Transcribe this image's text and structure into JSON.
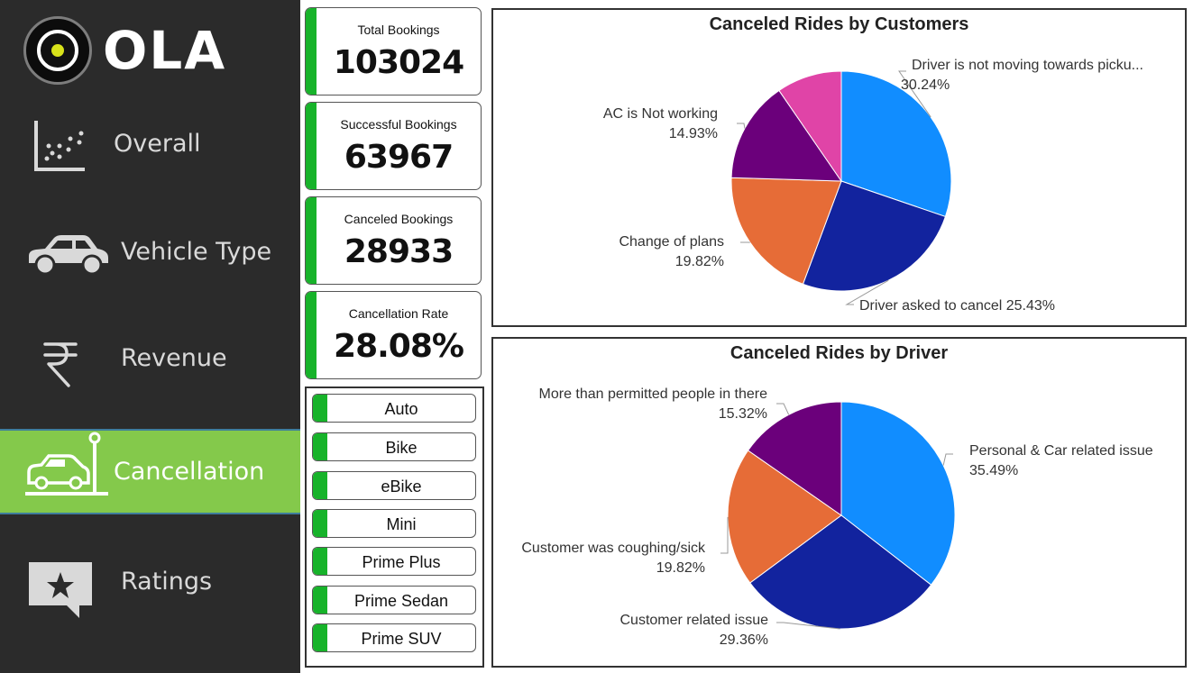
{
  "brand": {
    "name": "OLA"
  },
  "nav": {
    "items": [
      {
        "label": "Overall",
        "icon": "scatter-chart-icon"
      },
      {
        "label": "Vehicle Type",
        "icon": "car-icon"
      },
      {
        "label": "Revenue",
        "icon": "rupee-icon"
      },
      {
        "label": "Cancellation",
        "icon": "car-crash-icon"
      },
      {
        "label": "Ratings",
        "icon": "star-review-icon"
      }
    ],
    "active": "Cancellation"
  },
  "kpis": [
    {
      "title": "Total Bookings",
      "value": "103024"
    },
    {
      "title": "Successful Bookings",
      "value": "63967"
    },
    {
      "title": "Canceled Bookings",
      "value": "28933"
    },
    {
      "title": "Cancellation Rate",
      "value": "28.08%"
    }
  ],
  "vehicle_filter": {
    "options": [
      "Auto",
      "Bike",
      "eBike",
      "Mini",
      "Prime Plus",
      "Prime Sedan",
      "Prime SUV"
    ]
  },
  "colors": {
    "accent_green": "#17b32a",
    "active_nav": "#84c94b",
    "slice_1": "#118dff",
    "slice_2": "#12239e",
    "slice_3": "#e66c37",
    "slice_4": "#6b007b",
    "slice_5": "#e044a7"
  },
  "chart_data": [
    {
      "type": "pie",
      "title": "Canceled Rides by Customers",
      "slices": [
        {
          "label": "Driver is not moving towards picku...",
          "percent_label": "30.24%",
          "value": 30.24,
          "color": "#118dff"
        },
        {
          "label": "Driver asked to cancel",
          "percent_label": "25.43%",
          "value": 25.43,
          "color": "#12239e"
        },
        {
          "label": "Change of plans",
          "percent_label": "19.82%",
          "value": 19.82,
          "color": "#e66c37"
        },
        {
          "label": "AC is Not working",
          "percent_label": "14.93%",
          "value": 14.93,
          "color": "#6b007b"
        },
        {
          "label": "",
          "percent_label": "",
          "value": 9.58,
          "color": "#e044a7"
        }
      ]
    },
    {
      "type": "pie",
      "title": "Canceled Rides by Driver",
      "slices": [
        {
          "label": "Personal & Car related issue",
          "percent_label": "35.49%",
          "value": 35.49,
          "color": "#118dff"
        },
        {
          "label": "Customer related issue",
          "percent_label": "29.36%",
          "value": 29.36,
          "color": "#12239e"
        },
        {
          "label": "Customer was coughing/sick",
          "percent_label": "19.82%",
          "value": 19.82,
          "color": "#e66c37"
        },
        {
          "label": "More than permitted people in there",
          "percent_label": "15.32%",
          "value": 15.32,
          "color": "#6b007b"
        }
      ]
    }
  ]
}
